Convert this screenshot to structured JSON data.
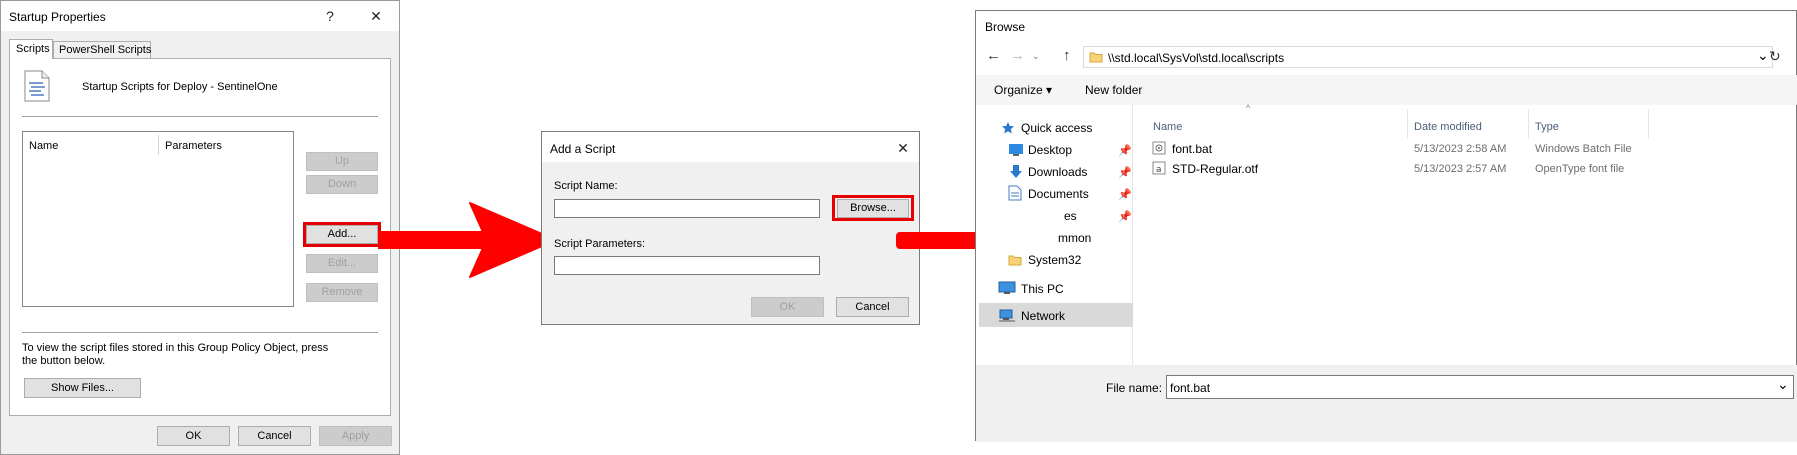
{
  "startup": {
    "title": "Startup Properties",
    "help": "?",
    "close": "✕",
    "tabs": [
      "Scripts",
      "PowerShell Scripts"
    ],
    "heading": "Startup Scripts for Deploy - SentinelOne",
    "columns": [
      "Name",
      "Parameters"
    ],
    "buttons": {
      "up": "Up",
      "down": "Down",
      "add": "Add...",
      "edit": "Edit...",
      "remove": "Remove"
    },
    "info_line1": "To view the script files stored in this Group Policy Object, press",
    "info_line2": "the button below.",
    "show_files": "Show Files...",
    "ok": "OK",
    "cancel": "Cancel",
    "apply": "Apply"
  },
  "add_script": {
    "title": "Add a Script",
    "close": "✕",
    "script_name_label": "Script Name:",
    "script_name_value": "",
    "browse": "Browse...",
    "script_params_label": "Script Parameters:",
    "script_params_value": "",
    "ok": "OK",
    "cancel": "Cancel"
  },
  "browse": {
    "title": "Browse",
    "back": "←",
    "forward": "→",
    "up": "↑",
    "address": "\\\\std.local\\SysVol\\std.local\\scripts",
    "dropdown": "⌄",
    "refresh": "↻",
    "organize": "Organize ▾",
    "new_folder": "New folder",
    "nav": {
      "quick_access": "Quick access",
      "desktop": "Desktop",
      "downloads": "Downloads",
      "documents": "Documents",
      "pictures_partial": "es",
      "common_partial": "mmon",
      "system32": "System32",
      "this_pc": "This PC",
      "network": "Network"
    },
    "columns": {
      "name": "Name",
      "date": "Date modified",
      "type": "Type"
    },
    "files": [
      {
        "name": "font.bat",
        "date": "5/13/2023 2:58 AM",
        "type": "Windows Batch File"
      },
      {
        "name": "STD-Regular.otf",
        "date": "5/13/2023 2:57 AM",
        "type": "OpenType font file"
      }
    ],
    "file_name_label": "File name:",
    "file_name_value": "font.bat"
  }
}
